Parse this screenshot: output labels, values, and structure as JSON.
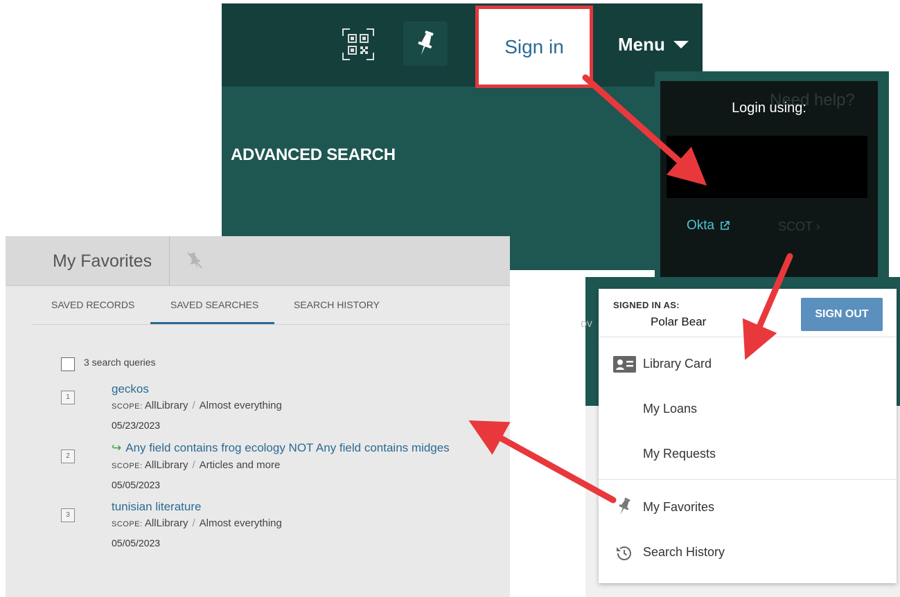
{
  "header": {
    "signin_label": "Sign in",
    "menu_label": "Menu",
    "advanced_search": "ADVANCED SEARCH"
  },
  "login": {
    "title": "Login using:",
    "ghost_title": "Need help?",
    "okta_label": "Okta",
    "ghost_link": "SCOT"
  },
  "favorites": {
    "title": "My Favorites",
    "tabs": [
      "SAVED RECORDS",
      "SAVED SEARCHES",
      "SEARCH HISTORY"
    ],
    "active_tab": "SAVED SEARCHES",
    "count_label": "3 search queries",
    "scope_key": "SCOPE:",
    "items": [
      {
        "num": "1",
        "query": "geckos",
        "scope": "AllLibrary",
        "collection": "Almost everything",
        "date": "05/23/2023",
        "advanced": false
      },
      {
        "num": "2",
        "query": "Any field contains frog ecology NOT Any field contains midges",
        "scope": "AllLibrary",
        "collection": "Articles and more",
        "date": "05/05/2023",
        "advanced": true
      },
      {
        "num": "3",
        "query": "tunisian literature",
        "scope": "AllLibrary",
        "collection": "Almost everything",
        "date": "05/05/2023",
        "advanced": false
      }
    ]
  },
  "user_menu": {
    "signed_in_label": "SIGNED IN AS:",
    "user_name": "Polar Bear",
    "sign_out": "SIGN OUT",
    "items": [
      "Library Card",
      "My Loans",
      "My Requests",
      "My Favorites",
      "Search History"
    ],
    "peek_text": "ov"
  },
  "colors": {
    "header_dark": "#143f3b",
    "header_teal": "#1e5651",
    "highlight_red": "#e0393e",
    "link_blue": "#2b6a94",
    "okta_cyan": "#4ec3d6",
    "sign_out_blue": "#5b8fbe"
  }
}
